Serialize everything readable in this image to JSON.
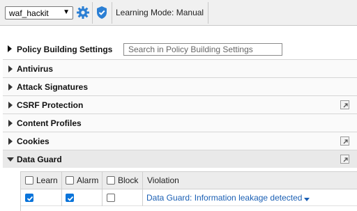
{
  "toolbar": {
    "policy_selected": "waf_hackit",
    "learning_mode": "Learning Mode: Manual"
  },
  "policy_building": {
    "title": "Policy Building Settings",
    "search_placeholder": "Search in Policy Building Settings"
  },
  "sections": [
    {
      "label": "Antivirus",
      "expanded": false,
      "has_link": false
    },
    {
      "label": "Attack Signatures",
      "expanded": false,
      "has_link": false
    },
    {
      "label": "CSRF Protection",
      "expanded": false,
      "has_link": true
    },
    {
      "label": "Content Profiles",
      "expanded": false,
      "has_link": false
    },
    {
      "label": "Cookies",
      "expanded": false,
      "has_link": true
    },
    {
      "label": "Data Guard",
      "expanded": true,
      "has_link": true
    }
  ],
  "data_guard_table": {
    "headers": {
      "learn": "Learn",
      "alarm": "Alarm",
      "block": "Block",
      "violation": "Violation"
    },
    "rows": [
      {
        "learn": true,
        "alarm": true,
        "block": false,
        "violation": "Data Guard: Information leakage detected"
      }
    ]
  },
  "colors": {
    "accent": "#0a74da",
    "link": "#1a5fb4",
    "toolbar_bg": "#f0f0f0"
  }
}
